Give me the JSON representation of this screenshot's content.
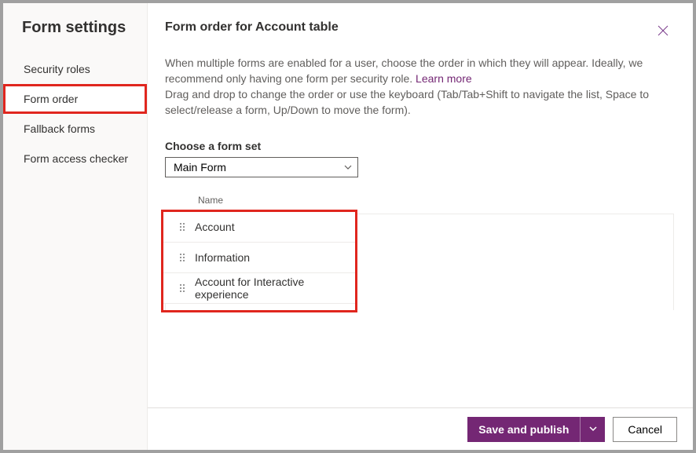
{
  "sidebar": {
    "title": "Form settings",
    "items": [
      {
        "label": "Security roles",
        "selected": false
      },
      {
        "label": "Form order",
        "selected": true
      },
      {
        "label": "Fallback forms",
        "selected": false
      },
      {
        "label": "Form access checker",
        "selected": false
      }
    ]
  },
  "page": {
    "title": "Form order for Account table",
    "desc1": "When multiple forms are enabled for a user, choose the order in which they will appear. Ideally, we recommend only having one form per security role. ",
    "learnMore": "Learn more",
    "desc2": "Drag and drop to change the order or use the keyboard (Tab/Tab+Shift to navigate the list, Space to select/release a form, Up/Down to move the form)."
  },
  "formSet": {
    "label": "Choose a form set",
    "selected": "Main Form"
  },
  "list": {
    "header": "Name",
    "rows": [
      {
        "name": "Account"
      },
      {
        "name": "Information"
      },
      {
        "name": "Account for Interactive experience"
      }
    ]
  },
  "footer": {
    "primary": "Save and publish",
    "cancel": "Cancel"
  }
}
